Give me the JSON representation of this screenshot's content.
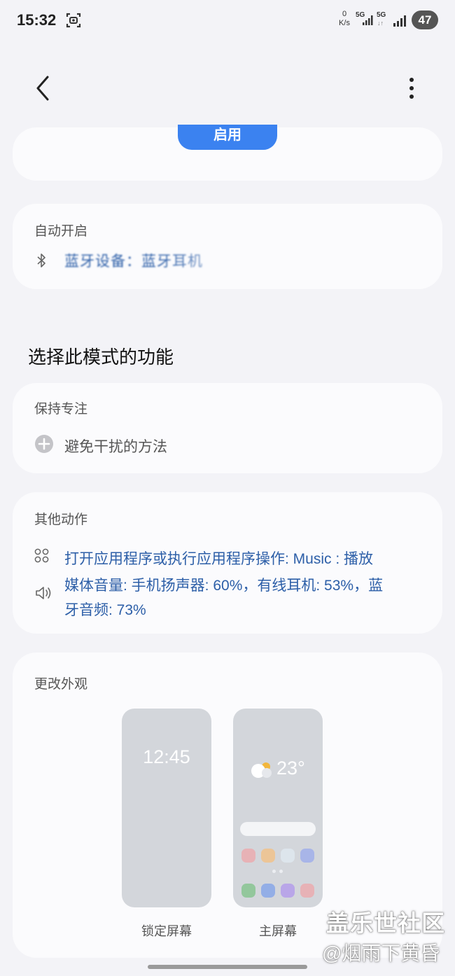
{
  "status_bar": {
    "time": "15:32",
    "net_speed_value": "0",
    "net_speed_unit": "K/s",
    "sim1": "5G",
    "sim2": "5G",
    "battery": "47"
  },
  "top_card": {
    "enable_label": "启用"
  },
  "auto_start": {
    "label": "自动开启",
    "trigger_text": "蓝牙设备：蓝牙耳机"
  },
  "features": {
    "heading": "选择此模式的功能",
    "stay_focused": {
      "label": "保持专注",
      "add_label": "避免干扰的方法"
    },
    "other_actions": {
      "label": "其他动作",
      "open_app_text": "打开应用程序或执行应用程序操作: Music : 播放",
      "media_volume_line1": "媒体音量: 手机扬声器: 60%，有线耳机: 53%，蓝",
      "media_volume_line2": "牙音频: 73%"
    },
    "appearance": {
      "label": "更改外观",
      "lock_time": "12:45",
      "weather_temp": "23°",
      "lock_caption": "锁定屏幕",
      "home_caption": "主屏幕"
    }
  },
  "watermark": {
    "line1": "盖乐世社区",
    "line2": "@烟雨下黄昏"
  },
  "colors": {
    "accent": "#3b82f0",
    "link": "#2d5fa8",
    "background": "#f3f3f7",
    "card": "#fbfbfd"
  }
}
